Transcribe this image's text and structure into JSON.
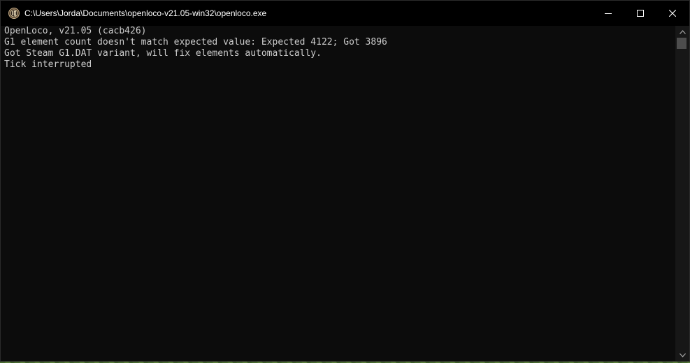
{
  "window": {
    "title": "C:\\Users\\Jorda\\Documents\\openloco-v21.05-win32\\openloco.exe",
    "icon": "openloco-app-icon",
    "controls": {
      "minimize_icon": "minimize-icon",
      "maximize_icon": "maximize-icon",
      "close_icon": "close-icon"
    }
  },
  "console": {
    "lines": [
      "OpenLoco, v21.05 (cacb426)",
      "G1 element count doesn't match expected value: Expected 4122; Got 3896",
      "Got Steam G1.DAT variant, will fix elements automatically.",
      "Tick interrupted"
    ],
    "text_color": "#cccccc",
    "background_color": "#0c0c0c"
  },
  "scrollbar": {
    "up_icon": "scroll-up-arrow-icon",
    "down_icon": "scroll-down-arrow-icon"
  }
}
